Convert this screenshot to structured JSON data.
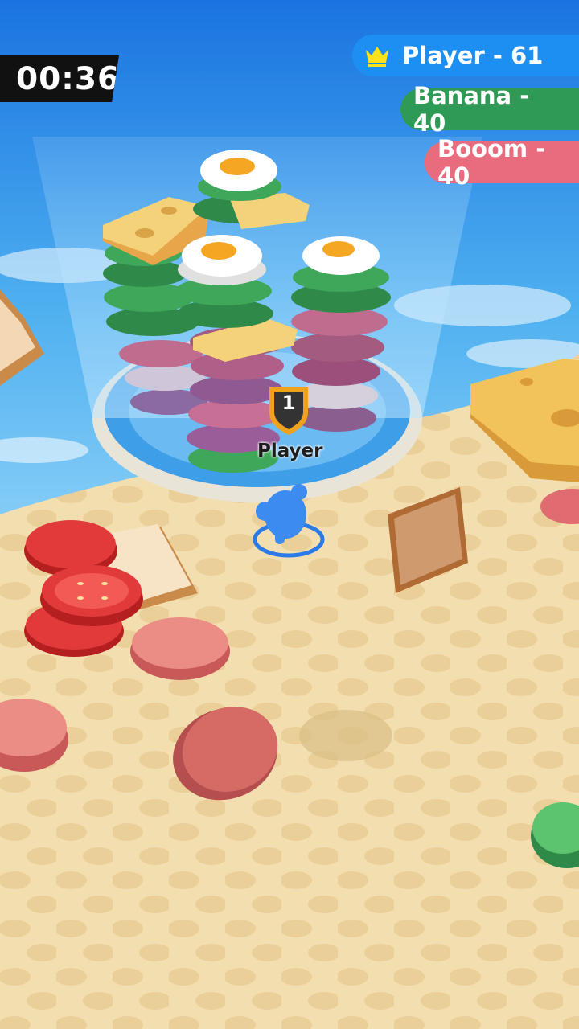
{
  "hud": {
    "timer": "00:36",
    "leaderboard": [
      {
        "name_score": "Player - 61",
        "color": "#1e8ff2",
        "icon": "crown-icon"
      },
      {
        "name_score": "Banana - 40",
        "color": "#2f9a55"
      },
      {
        "name_score": "Booom - 40",
        "color": "#e96c7e"
      }
    ]
  },
  "player": {
    "label": "Player",
    "rank": "1",
    "color": "#3b8bf0"
  },
  "colors": {
    "sky": "#4fa9ee",
    "sand": "#f3deb0",
    "tower_glow": "#9bd3f6"
  }
}
